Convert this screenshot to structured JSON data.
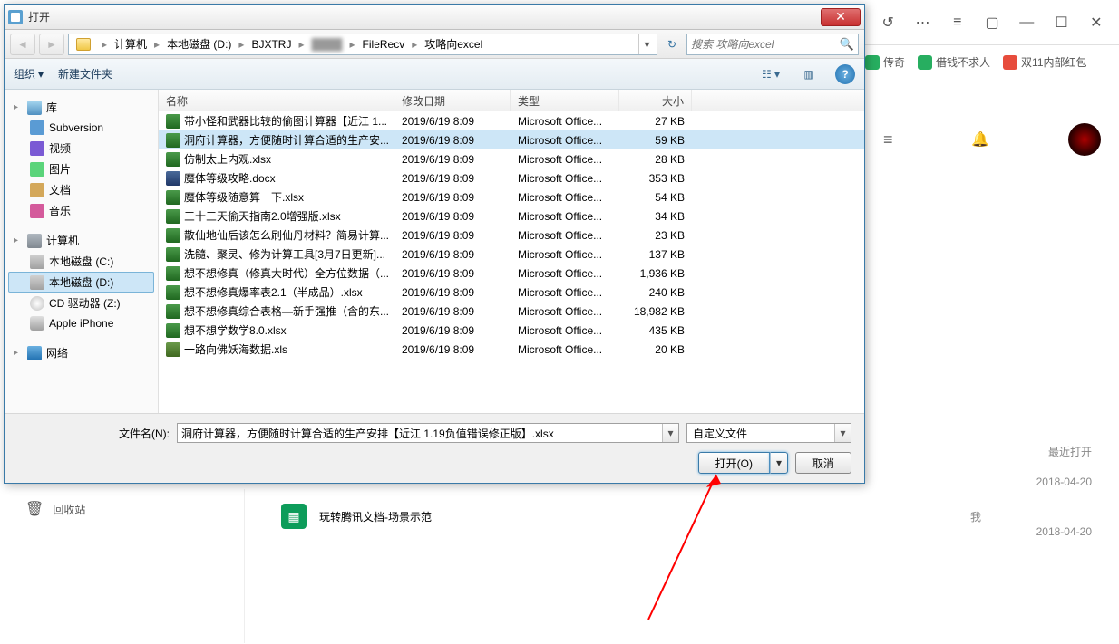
{
  "background": {
    "bookmarks": [
      {
        "label": "传奇",
        "color": "fav-green"
      },
      {
        "label": "借钱不求人",
        "color": "fav-green"
      },
      {
        "label": "双11内部红包",
        "color": "fav-red"
      }
    ],
    "recent_label": "最近打开",
    "date1": "2018-04-20",
    "date2": "2018-04-20",
    "trash_label": "回收站",
    "main_doc": "玩转腾讯文档-场景示范",
    "owner": "我"
  },
  "dialog": {
    "title": "打开",
    "breadcrumb": [
      "计算机",
      "本地磁盘 (D:)",
      "BJXTRJ",
      "████",
      "FileRecv",
      "攻略向excel"
    ],
    "search_placeholder": "搜索 攻略向excel",
    "toolbar": {
      "organize": "组织",
      "newfolder": "新建文件夹"
    },
    "tree": {
      "libraries": "库",
      "lib_items": [
        "Subversion",
        "视频",
        "图片",
        "文档",
        "音乐"
      ],
      "computer": "计算机",
      "comp_items": [
        "本地磁盘 (C:)",
        "本地磁盘 (D:)",
        "CD 驱动器 (Z:)",
        "Apple iPhone"
      ],
      "network": "网络"
    },
    "columns": {
      "name": "名称",
      "date": "修改日期",
      "type": "类型",
      "size": "大小"
    },
    "files": [
      {
        "icon": "ico-xlsx",
        "name": "带小怪和武器比较的偷图计算器【近江 1...",
        "date": "2019/6/19 8:09",
        "type": "Microsoft Office...",
        "size": "27 KB",
        "sel": false
      },
      {
        "icon": "ico-xlsx",
        "name": "洞府计算器，方便随时计算合适的生产安...",
        "date": "2019/6/19 8:09",
        "type": "Microsoft Office...",
        "size": "59 KB",
        "sel": true
      },
      {
        "icon": "ico-xlsx",
        "name": "仿制太上内观.xlsx",
        "date": "2019/6/19 8:09",
        "type": "Microsoft Office...",
        "size": "28 KB",
        "sel": false
      },
      {
        "icon": "ico-docx",
        "name": "魔体等级攻略.docx",
        "date": "2019/6/19 8:09",
        "type": "Microsoft Office...",
        "size": "353 KB",
        "sel": false
      },
      {
        "icon": "ico-xlsx",
        "name": "魔体等级随意算一下.xlsx",
        "date": "2019/6/19 8:09",
        "type": "Microsoft Office...",
        "size": "54 KB",
        "sel": false
      },
      {
        "icon": "ico-xlsx",
        "name": "三十三天偷天指南2.0增强版.xlsx",
        "date": "2019/6/19 8:09",
        "type": "Microsoft Office...",
        "size": "34 KB",
        "sel": false
      },
      {
        "icon": "ico-xlsx",
        "name": "散仙地仙后该怎么刷仙丹材料？简易计算...",
        "date": "2019/6/19 8:09",
        "type": "Microsoft Office...",
        "size": "23 KB",
        "sel": false
      },
      {
        "icon": "ico-xlsx",
        "name": "洗髓、聚灵、修为计算工具[3月7日更新]...",
        "date": "2019/6/19 8:09",
        "type": "Microsoft Office...",
        "size": "137 KB",
        "sel": false
      },
      {
        "icon": "ico-xlsx",
        "name": "想不想修真（修真大时代）全方位数据（...",
        "date": "2019/6/19 8:09",
        "type": "Microsoft Office...",
        "size": "1,936 KB",
        "sel": false
      },
      {
        "icon": "ico-xlsx",
        "name": "想不想修真爆率表2.1（半成品）.xlsx",
        "date": "2019/6/19 8:09",
        "type": "Microsoft Office...",
        "size": "240 KB",
        "sel": false
      },
      {
        "icon": "ico-xlsx",
        "name": "想不想修真综合表格—新手强推（含的东...",
        "date": "2019/6/19 8:09",
        "type": "Microsoft Office...",
        "size": "18,982 KB",
        "sel": false
      },
      {
        "icon": "ico-xlsx",
        "name": "想不想学数学8.0.xlsx",
        "date": "2019/6/19 8:09",
        "type": "Microsoft Office...",
        "size": "435 KB",
        "sel": false
      },
      {
        "icon": "ico-xls",
        "name": "一路向佛妖海数据.xls",
        "date": "2019/6/19 8:09",
        "type": "Microsoft Office...",
        "size": "20 KB",
        "sel": false
      }
    ],
    "filename_label": "文件名(N):",
    "filename_value": "洞府计算器，方便随时计算合适的生产安排【近江 1.19负值错误修正版】.xlsx",
    "filter_value": "自定义文件",
    "open_btn": "打开(O)",
    "cancel_btn": "取消"
  }
}
